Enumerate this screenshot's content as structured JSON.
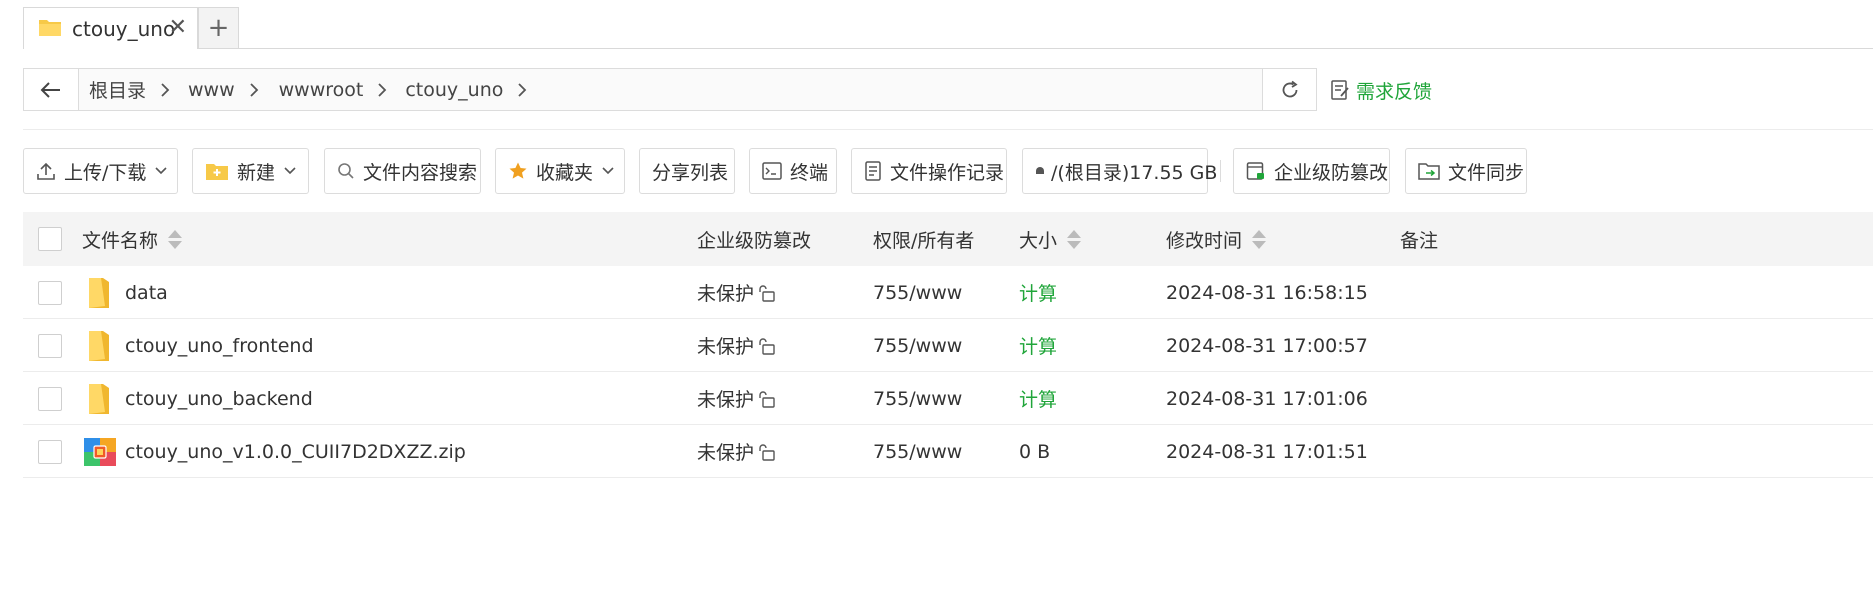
{
  "tabs": {
    "active_label": "ctouy_uno",
    "close_glyph": "✕",
    "add_glyph": "+"
  },
  "breadcrumb": [
    "根目录",
    "www",
    "wwwroot",
    "ctouy_uno"
  ],
  "feedback_label": "需求反馈",
  "toolbar": {
    "upload_download": "上传/下载",
    "new": "新建",
    "content_search": "文件内容搜索",
    "favorites": "收藏夹",
    "share_list": "分享列表",
    "terminal": "终端",
    "operation_log": "文件操作记录",
    "disk": "/(根目录)17.55 GB",
    "anti_tamper": "企业级防篡改",
    "file_sync": "文件同步"
  },
  "table": {
    "headers": {
      "name": "文件名称",
      "protect": "企业级防篡改",
      "perm": "权限/所有者",
      "size": "大小",
      "mtime": "修改时间",
      "remark": "备注"
    },
    "rows": [
      {
        "name": "data",
        "type": "folder",
        "protect": "未保护",
        "perm": "755/www",
        "size": "计算",
        "mtime": "2024-08-31 16:58:15"
      },
      {
        "name": "ctouy_uno_frontend",
        "type": "folder",
        "protect": "未保护",
        "perm": "755/www",
        "size": "计算",
        "mtime": "2024-08-31 17:00:57"
      },
      {
        "name": "ctouy_uno_backend",
        "type": "folder",
        "protect": "未保护",
        "perm": "755/www",
        "size": "计算",
        "mtime": "2024-08-31 17:01:06"
      },
      {
        "name": "ctouy_uno_v1.0.0_CUII7D2DXZZ.zip",
        "type": "zip",
        "protect": "未保护",
        "perm": "755/www",
        "size": "0 B",
        "mtime": "2024-08-31 17:01:51"
      }
    ]
  },
  "colors": {
    "accent_green": "#20a53a",
    "folder_yellow": "#f7c948",
    "header_bg": "#f4f4f4"
  }
}
